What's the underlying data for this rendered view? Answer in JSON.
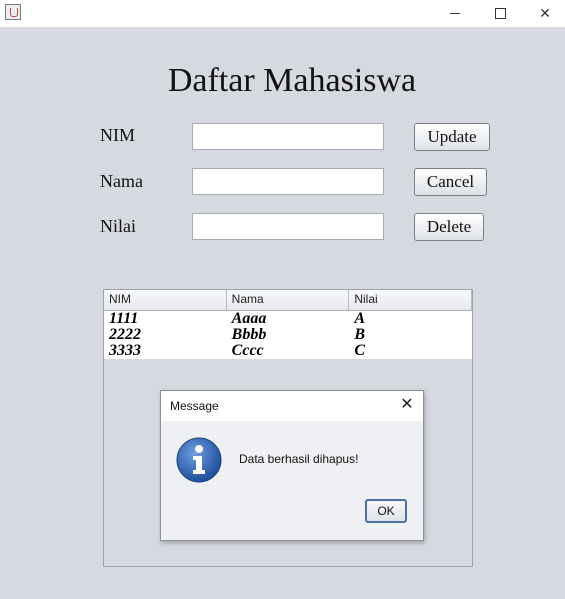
{
  "window": {
    "minimize_glyph": "",
    "maximize_glyph": "",
    "close_glyph": "✕"
  },
  "form": {
    "title": "Daftar Mahasiswa",
    "fields": [
      {
        "label": "NIM",
        "value": ""
      },
      {
        "label": "Nama",
        "value": ""
      },
      {
        "label": "Nilai",
        "value": ""
      }
    ],
    "buttons": {
      "update": "Update",
      "cancel": "Cancel",
      "delete": "Delete"
    }
  },
  "table": {
    "columns": [
      "NIM",
      "Nama",
      "Nilai"
    ],
    "rows": [
      [
        "1111",
        "Aaaa",
        "A"
      ],
      [
        "2222",
        "Bbbb",
        "B"
      ],
      [
        "3333",
        "Cccc",
        "C"
      ]
    ]
  },
  "dialog": {
    "title": "Message",
    "close_glyph": "✕",
    "message": "Data berhasil dihapus!",
    "ok_label": "OK",
    "icon": "info-icon"
  },
  "colors": {
    "background": "#d6d9e0",
    "info_icon": "#2f63b3"
  }
}
